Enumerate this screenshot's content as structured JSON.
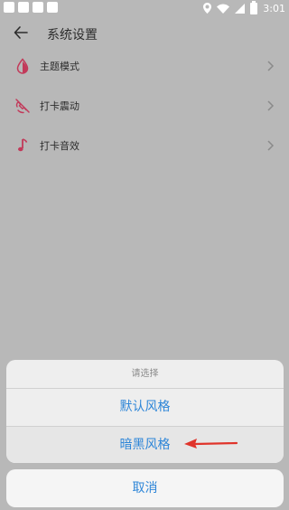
{
  "status_bar": {
    "time": "3:01",
    "icons": [
      "location-icon",
      "wifi-icon",
      "signal-icon",
      "battery-icon"
    ]
  },
  "header": {
    "title": "系统设置",
    "back_icon": "back-arrow-icon"
  },
  "settings": [
    {
      "label": "主题模式",
      "icon": "water-drop-icon"
    },
    {
      "label": "打卡震动",
      "icon": "vibration-off-icon"
    },
    {
      "label": "打卡音效",
      "icon": "music-note-icon"
    }
  ],
  "action_sheet": {
    "title": "请选择",
    "options": [
      "默认风格",
      "暗黑风格"
    ],
    "cancel": "取消"
  },
  "colors": {
    "accent": "#2e86d8",
    "icon_accent": "#c23a5a",
    "annotation_arrow": "#e0342b"
  }
}
